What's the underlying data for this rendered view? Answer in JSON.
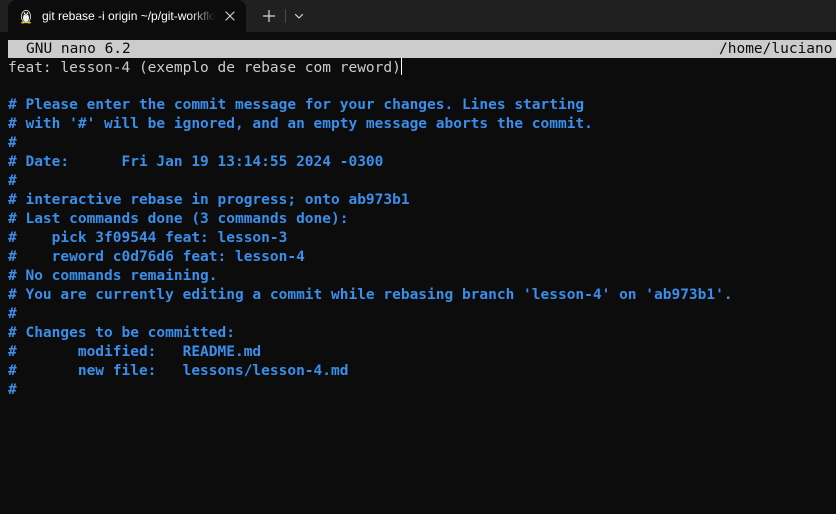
{
  "tab": {
    "title": "git rebase -i origin ~/p/git-workflow",
    "icon": "linux-penguin-icon"
  },
  "editor": {
    "header_version": "GNU nano 6.2",
    "header_path": "/home/luciano",
    "first_line": "feat: lesson-4 (exemplo de rebase com reword)",
    "comment_lines": [
      "",
      "# Please enter the commit message for your changes. Lines starting",
      "# with '#' will be ignored, and an empty message aborts the commit.",
      "#",
      "# Date:      Fri Jan 19 13:14:55 2024 -0300",
      "#",
      "# interactive rebase in progress; onto ab973b1",
      "# Last commands done (3 commands done):",
      "#    pick 3f09544 feat: lesson-3",
      "#    reword c0d76d6 feat: lesson-4",
      "# No commands remaining.",
      "# You are currently editing a commit while rebasing branch 'lesson-4' on 'ab973b1'.",
      "#",
      "# Changes to be committed:",
      "#       modified:   README.md",
      "#       new file:   lessons/lesson-4.md",
      "#"
    ]
  },
  "colors": {
    "background": "#0c0c0c",
    "tabbar": "#202020",
    "text": "#cccccc",
    "comment": "#3b8eea",
    "header_bg": "#cccccc"
  }
}
